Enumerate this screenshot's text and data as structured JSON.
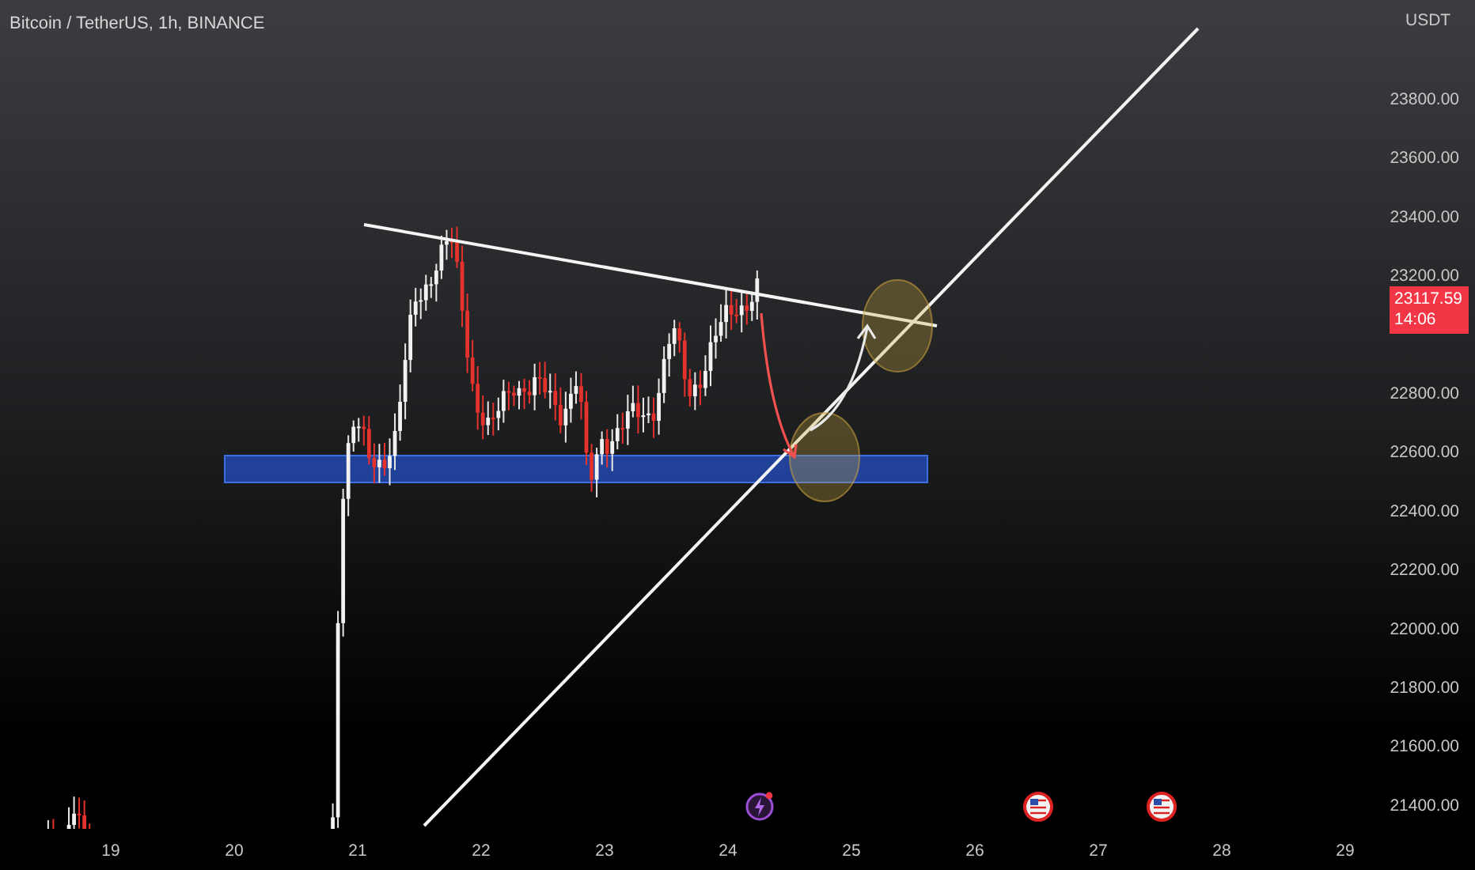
{
  "title": "Bitcoin / TetherUS, 1h, BINANCE",
  "price_axis": {
    "currency": "USDT",
    "labels": [
      "23800.00",
      "23600.00",
      "23400.00",
      "23200.00",
      "22800.00",
      "22600.00",
      "22400.00",
      "22200.00",
      "22000.00",
      "21800.00",
      "21600.00",
      "21400.00"
    ],
    "last_price": "23117.59",
    "countdown": "14:06"
  },
  "time_axis": {
    "labels": [
      "19",
      "20",
      "21",
      "22",
      "23",
      "24",
      "25",
      "26",
      "27",
      "28",
      "29"
    ]
  },
  "events": [
    {
      "kind": "lightning"
    },
    {
      "kind": "flag"
    },
    {
      "kind": "flag"
    }
  ]
}
